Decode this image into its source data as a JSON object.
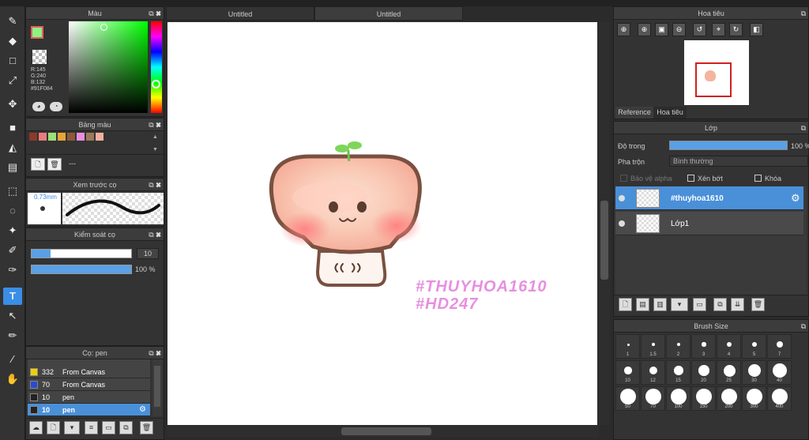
{
  "tabs": [
    "Untitled",
    "Untitled"
  ],
  "color_panel": {
    "title": "Màu",
    "r": "R:145",
    "g": "G:240",
    "b": "B:132",
    "hex": "#91F084",
    "primary": "#91F084"
  },
  "palette_panel": {
    "title": "Bảng màu",
    "swatches": [
      "#8b3a2a",
      "#e87c7c",
      "#9be07a",
      "#e8a43a",
      "#8a5a3a",
      "#e890e0",
      "#9a7a5a",
      "#f3b0a0"
    ],
    "empty_label": "---"
  },
  "brush_preview_panel": {
    "title": "Xem trước cọ",
    "size_label": "0.73mm"
  },
  "brush_control_panel": {
    "title": "Kiểm soát cọ",
    "size_value": "10",
    "opacity_value": "100 %"
  },
  "brush_panel": {
    "title": "Cọ: pen",
    "items": [
      {
        "swatch": "#f0d000",
        "size": "332",
        "name": "From Canvas"
      },
      {
        "swatch": "#2a4ad0",
        "size": "70",
        "name": "From Canvas"
      },
      {
        "swatch": "#222222",
        "size": "10",
        "name": "pen"
      },
      {
        "swatch": "#222222",
        "size": "10",
        "name": "pen"
      }
    ]
  },
  "canvas": {
    "watermark_line1": "#THUYHOA1610",
    "watermark_line2": "#HD247"
  },
  "navigator_panel": {
    "title": "Hoa tiêu",
    "tab_reference": "Reference",
    "tab_navigator": "Hoa tiêu"
  },
  "layer_panel": {
    "title": "Lớp",
    "opacity_label": "Độ trong",
    "opacity_value": "100 %",
    "blend_label": "Pha trộn",
    "blend_value": "Bình thường",
    "protect_alpha": "Bảo vệ alpha",
    "clipping": "Xén bớt",
    "lock": "Khóa",
    "layers": [
      {
        "name": "#thuyhoa1610",
        "selected": true
      },
      {
        "name": "Lớp1",
        "selected": false
      }
    ]
  },
  "brush_size_panel": {
    "title": "Brush Size",
    "row1": [
      "1",
      "1.5",
      "2",
      "3",
      "4",
      "5",
      "7"
    ],
    "row2": [
      "10",
      "12",
      "15",
      "20",
      "25",
      "30",
      "40"
    ],
    "row3": [
      "50",
      "70",
      "100",
      "150",
      "200",
      "300",
      "400"
    ]
  }
}
